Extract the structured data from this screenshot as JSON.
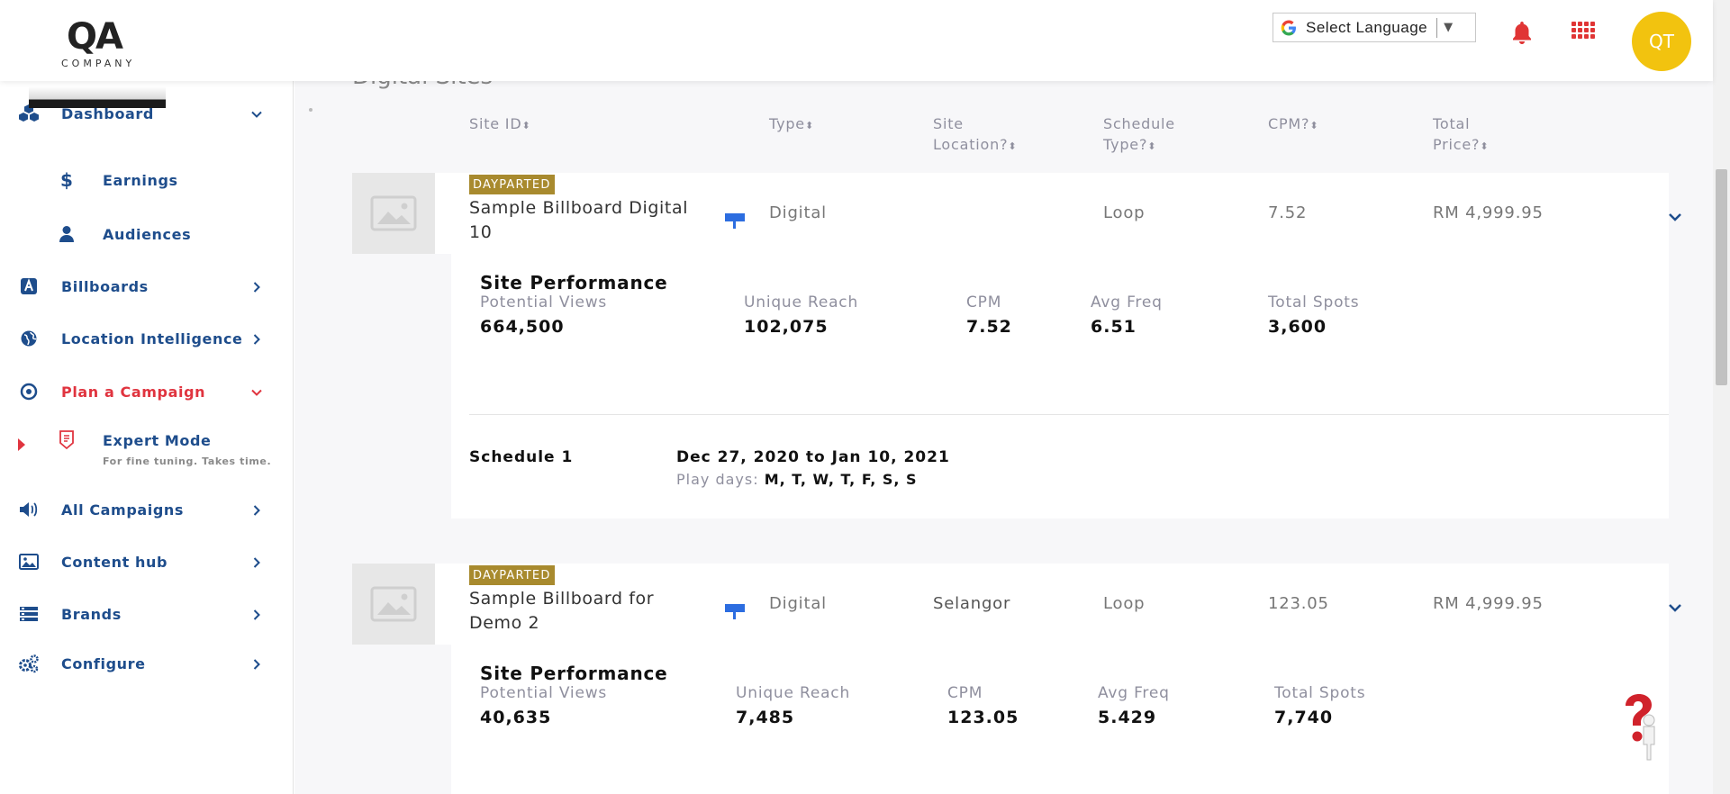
{
  "header": {
    "logo_main": "QA",
    "logo_sub": "COMPANY",
    "language_label": "Select Language",
    "avatar_initials": "QT",
    "accent_color": "#f2c30f",
    "alert_color": "#e03535"
  },
  "sidebar": {
    "items": [
      {
        "label": "Dashboard",
        "icon": "cubes-icon"
      },
      {
        "label": "Earnings",
        "icon": "dollar-icon"
      },
      {
        "label": "Audiences",
        "icon": "user-icon"
      },
      {
        "label": "Billboards",
        "icon": "billboard-icon"
      },
      {
        "label": "Location Intelligence",
        "icon": "globe-icon"
      },
      {
        "label": "Plan a Campaign",
        "icon": "target-icon"
      },
      {
        "label": "Expert Mode",
        "icon": "badge-icon",
        "hint": "For fine tuning. Takes time."
      },
      {
        "label": "All Campaigns",
        "icon": "speaker-icon"
      },
      {
        "label": "Content hub",
        "icon": "image-icon"
      },
      {
        "label": "Brands",
        "icon": "list-icon"
      },
      {
        "label": "Configure",
        "icon": "cogs-icon"
      }
    ]
  },
  "table": {
    "section_title": "Digital Sites",
    "columns": {
      "site_id": "Site ID",
      "type": "Type",
      "site_location_1": "Site",
      "site_location_2": "Location?",
      "schedule_type_1": "Schedule",
      "schedule_type_2": "Type?",
      "cpm": "CPM?",
      "total_price_1": "Total",
      "total_price_2": "Price?"
    },
    "rows": [
      {
        "badge": "DAYPARTED",
        "name": "Sample Billboard Digital 10",
        "type": "Digital",
        "location": "",
        "schedule_type": "Loop",
        "cpm": "7.52",
        "total_price": "RM 4,999.95",
        "performance": {
          "title": "Site Performance",
          "labels": [
            "Potential Views",
            "Unique Reach",
            "CPM",
            "Avg Freq",
            "Total Spots"
          ],
          "values": [
            "664,500",
            "102,075",
            "7.52",
            "6.51",
            "3,600"
          ]
        },
        "schedule": {
          "label": "Schedule 1",
          "range": "Dec 27, 2020 to Jan 10, 2021",
          "days_prefix": "Play days:",
          "days": "M, T, W, T, F, S, S"
        }
      },
      {
        "badge": "DAYPARTED",
        "name": "Sample Billboard for Demo 2",
        "type": "Digital",
        "location": "Selangor",
        "schedule_type": "Loop",
        "cpm": "123.05",
        "total_price": "RM 4,999.95",
        "performance": {
          "title": "Site Performance",
          "labels": [
            "Potential Views",
            "Unique Reach",
            "CPM",
            "Avg Freq",
            "Total Spots"
          ],
          "values": [
            "40,635",
            "7,485",
            "123.05",
            "5.429",
            "7,740"
          ]
        }
      }
    ]
  }
}
